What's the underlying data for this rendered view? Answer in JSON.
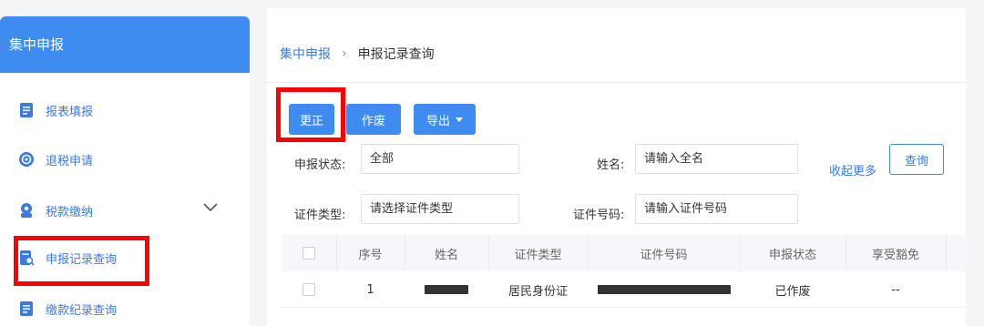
{
  "sidebar": {
    "title": "集中申报",
    "items": [
      {
        "label": "报表填报",
        "icon": "report-icon"
      },
      {
        "label": "退税申请",
        "icon": "refund-icon"
      },
      {
        "label": "税款缴纳",
        "icon": "tax-payment-icon"
      },
      {
        "label": "申报记录查询",
        "icon": "record-search-icon"
      },
      {
        "label": "缴款纪录查询",
        "icon": "payment-record-icon"
      }
    ]
  },
  "breadcrumb": {
    "parent": "集中申报",
    "separator": "›",
    "current": "申报记录查询"
  },
  "toolbar": {
    "correct_label": "更正",
    "void_label": "作废",
    "export_label": "导出"
  },
  "filters": {
    "status_label": "申报状态:",
    "status_value": "全部",
    "name_label": "姓名:",
    "name_placeholder": "请输入全名",
    "idtype_label": "证件类型:",
    "idtype_placeholder": "请选择证件类型",
    "idnum_label": "证件号码:",
    "idnum_placeholder": "请输入证件号码",
    "collapse_label": "收起更多",
    "query_label": "查询"
  },
  "table": {
    "headers": [
      "序号",
      "姓名",
      "证件类型",
      "证件号码",
      "申报状态",
      "享受豁免"
    ],
    "rows": [
      {
        "index": "1",
        "id_type": "居民身份证",
        "status": "已作废",
        "exempt": "--"
      }
    ]
  },
  "colors": {
    "accent": "#3f8cf0",
    "highlight": "#ff0000"
  }
}
